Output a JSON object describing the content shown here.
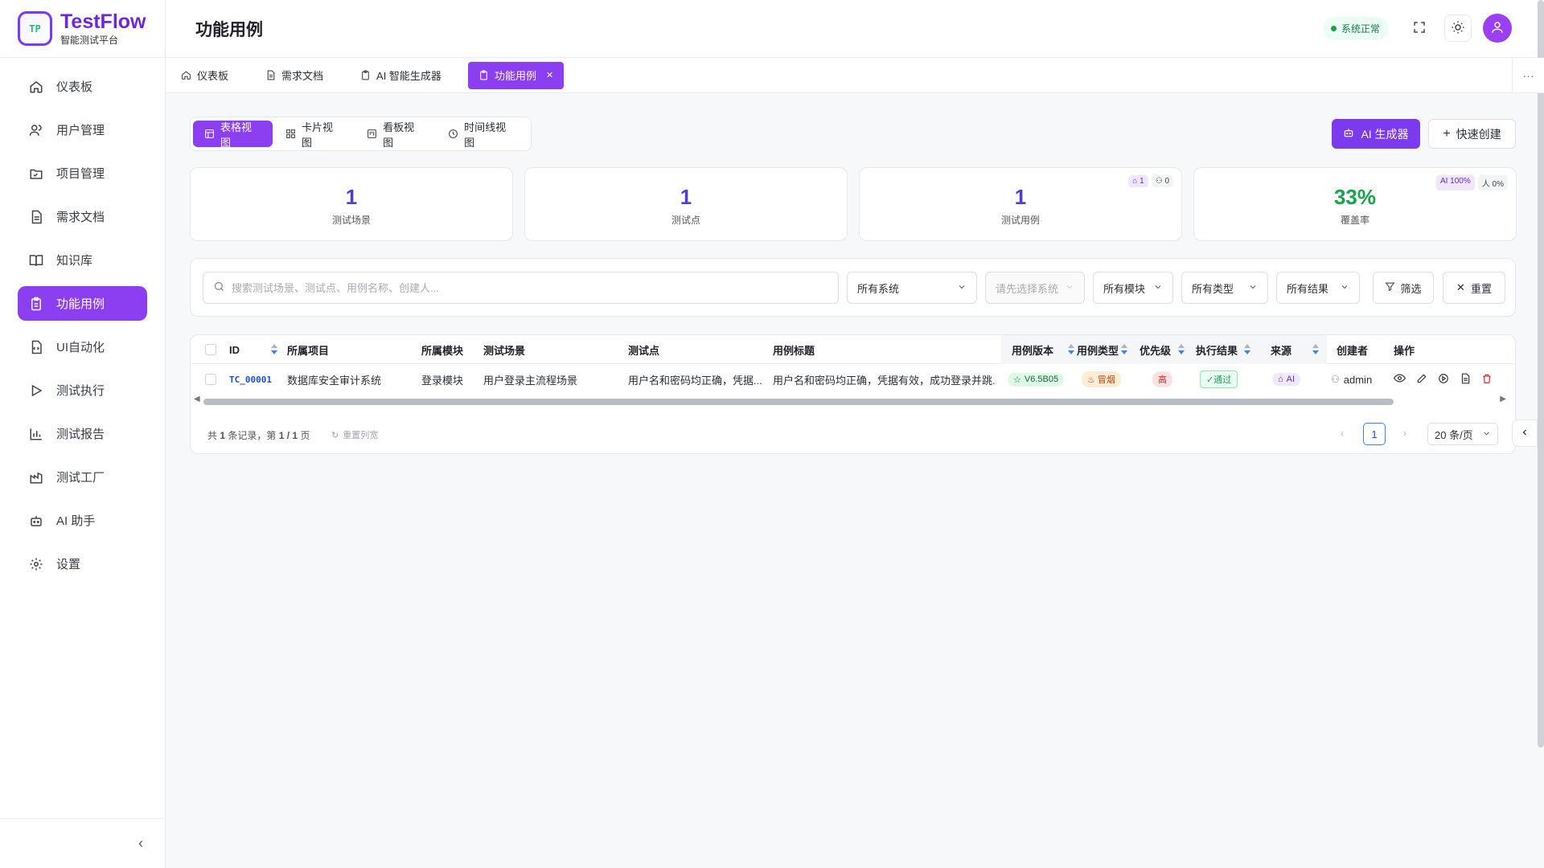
{
  "app": {
    "name": "TestFlow",
    "subtitle": "智能测试平台",
    "logo_text": "TP"
  },
  "sidebar": {
    "items": [
      {
        "label": "仪表板",
        "icon": "home-icon"
      },
      {
        "label": "用户管理",
        "icon": "users-icon"
      },
      {
        "label": "项目管理",
        "icon": "folder-icon"
      },
      {
        "label": "需求文档",
        "icon": "document-icon"
      },
      {
        "label": "知识库",
        "icon": "book-icon"
      },
      {
        "label": "功能用例",
        "icon": "clipboard-icon",
        "active": true
      },
      {
        "label": "UI自动化",
        "icon": "file-code-icon"
      },
      {
        "label": "测试执行",
        "icon": "play-icon"
      },
      {
        "label": "测试报告",
        "icon": "bar-chart-icon"
      },
      {
        "label": "测试工厂",
        "icon": "factory-icon"
      },
      {
        "label": "AI 助手",
        "icon": "robot-icon"
      },
      {
        "label": "设置",
        "icon": "gear-icon"
      }
    ]
  },
  "header": {
    "title": "功能用例",
    "status": "系统正常"
  },
  "tabs": [
    {
      "label": "仪表板",
      "icon": "home-icon"
    },
    {
      "label": "需求文档",
      "icon": "document-icon"
    },
    {
      "label": "AI 智能生成器",
      "icon": "clipboard-icon"
    },
    {
      "label": "功能用例",
      "icon": "clipboard-icon",
      "active": true,
      "closable": true
    }
  ],
  "views": [
    {
      "label": "表格视图",
      "icon": "table-icon",
      "active": true
    },
    {
      "label": "卡片视图",
      "icon": "grid-icon"
    },
    {
      "label": "看板视图",
      "icon": "kanban-icon"
    },
    {
      "label": "时间线视图",
      "icon": "clock-icon"
    }
  ],
  "actions": {
    "ai_generator": "AI 生成器",
    "quick_create": "快速创建"
  },
  "stats": [
    {
      "value": "1",
      "label": "测试场景"
    },
    {
      "value": "1",
      "label": "测试点"
    },
    {
      "value": "1",
      "label": "测试用例",
      "badges": [
        "1",
        "0"
      ]
    },
    {
      "value": "33%",
      "label": "覆盖率",
      "badges": [
        "AI 100%",
        "人 0%"
      ]
    }
  ],
  "filters": {
    "search_placeholder": "搜索测试场景、测试点、用例名称、创建人...",
    "system": "所有系统",
    "subsystem_placeholder": "请先选择系统",
    "module": "所有模块",
    "type": "所有类型",
    "result": "所有结果",
    "filter_btn": "筛选",
    "reset_btn": "重置"
  },
  "table": {
    "columns": [
      "ID",
      "所属项目",
      "所属模块",
      "测试场景",
      "测试点",
      "用例标题",
      "用例版本",
      "用例类型",
      "优先级",
      "执行结果",
      "来源",
      "创建者",
      "操作"
    ],
    "rows": [
      {
        "id": "TC_00001",
        "project": "数据库安全审计系统",
        "module": "登录模块",
        "scenario": "用户登录主流程场景",
        "point": "用户名和密码均正确，凭据...",
        "title": "用户名和密码均正确，凭据有效，成功登录并跳...",
        "version": "V6.5B05",
        "type": "冒烟",
        "priority": "高",
        "result": "✓通过",
        "source": "AI",
        "creator": "admin"
      }
    ]
  },
  "pagination": {
    "summary_prefix": "共",
    "total": "1",
    "summary_mid": "条记录，第",
    "page_info": "1 / 1",
    "summary_suffix": "页",
    "reset_columns": "重置列宽",
    "current_page": "1",
    "page_size": "20 条/页"
  },
  "colors": {
    "accent": "#8b3ff0",
    "accent_dark": "#7c3aed",
    "stat_number": "#4f3bd8",
    "coverage": "#16a34a"
  }
}
